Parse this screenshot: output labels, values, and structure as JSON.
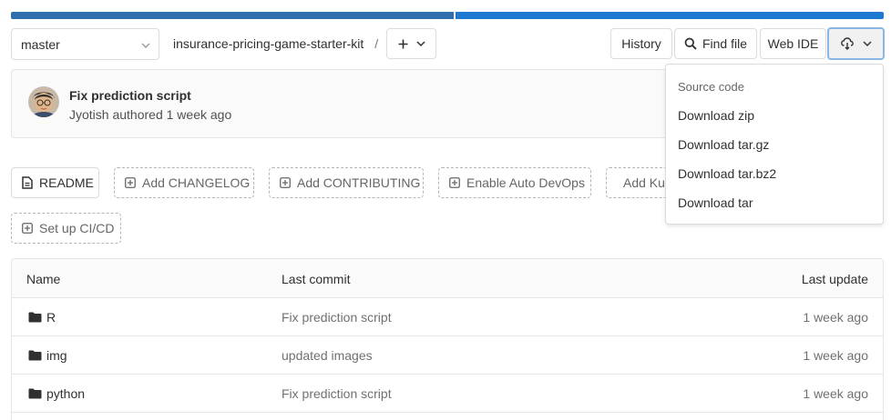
{
  "repo": {
    "branch": "master",
    "project_path": "insurance-pricing-game-starter-kit",
    "separator": "/"
  },
  "toolbar": {
    "history_label": "History",
    "find_file_label": "Find file",
    "web_ide_label": "Web IDE"
  },
  "commit": {
    "title": "Fix prediction script",
    "meta": "Jyotish authored 1 week ago"
  },
  "quick_actions": {
    "readme": "README",
    "changelog": "Add CHANGELOG",
    "contributing": "Add CONTRIBUTING",
    "auto_devops": "Enable Auto DevOps",
    "kubernetes": "Add Kubernetes cluster",
    "cicd": "Set up CI/CD"
  },
  "table": {
    "headers": {
      "name": "Name",
      "last_commit": "Last commit",
      "last_update": "Last update"
    },
    "rows": [
      {
        "name": "R",
        "commit": "Fix prediction script",
        "date": "1 week ago"
      },
      {
        "name": "img",
        "commit": "updated images",
        "date": "1 week ago"
      },
      {
        "name": "python",
        "commit": "Fix prediction script",
        "date": "1 week ago"
      }
    ]
  },
  "download_menu": {
    "header": "Source code",
    "items": [
      "Download zip",
      "Download tar.gz",
      "Download tar.bz2",
      "Download tar"
    ]
  },
  "colors": {
    "progress_left": "#2f6fad",
    "progress_right": "#1f78d1",
    "focus_ring": "#89b6e6"
  }
}
